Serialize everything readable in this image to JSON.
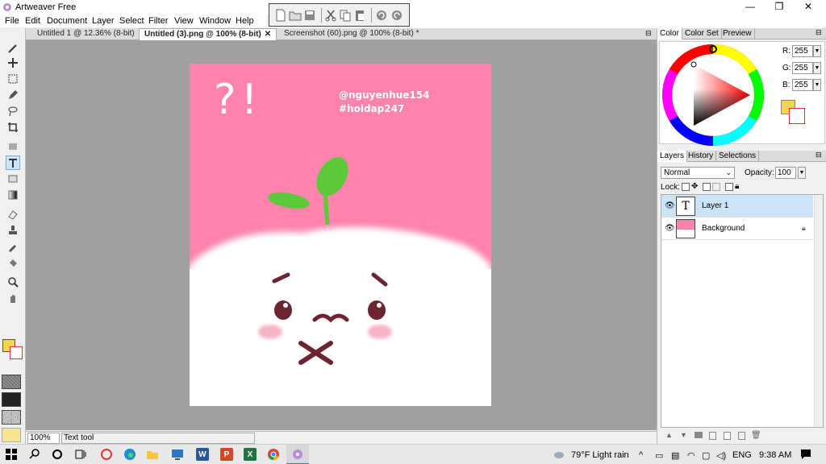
{
  "window": {
    "title": "Artweaver Free",
    "minimize": "—",
    "maximize": "❐",
    "close": "✕"
  },
  "menu": [
    "File",
    "Edit",
    "Document",
    "Layer",
    "Select",
    "Filter",
    "View",
    "Window",
    "Help"
  ],
  "tabs": [
    {
      "label": "Untitled 1 @ 12.36% (8-bit)",
      "active": false
    },
    {
      "label": "Untitled (3).png @ 100% (8-bit)",
      "active": true,
      "close": "✕"
    },
    {
      "label": "Screenshot (60).png @ 100% (8-bit) *",
      "active": false
    }
  ],
  "canvas": {
    "handle": "@nguyenhue154",
    "tag": "#hoidap247",
    "marks": "?!"
  },
  "status": {
    "zoom": "100%",
    "tool": "Text tool"
  },
  "color_panel": {
    "tabs": [
      "Color",
      "Color Set",
      "Preview"
    ],
    "r_label": "R:",
    "r": "255",
    "g_label": "G:",
    "g": "255",
    "b_label": "B:",
    "b": "255",
    "primary_color": "#f5d44f",
    "secondary_color": "#ffffff"
  },
  "layers_panel": {
    "tabs": [
      "Layers",
      "History",
      "Selections"
    ],
    "blend_mode": "Normal",
    "opacity_label": "Opacity:",
    "opacity": "100",
    "lock_label": "Lock:",
    "layers": [
      {
        "name": "Layer 1",
        "thumb": "T",
        "selected": true
      },
      {
        "name": "Background",
        "selected": false
      }
    ]
  },
  "taskbar": {
    "weather": "79°F  Light rain",
    "language": "ENG",
    "time": "9:38 AM"
  }
}
